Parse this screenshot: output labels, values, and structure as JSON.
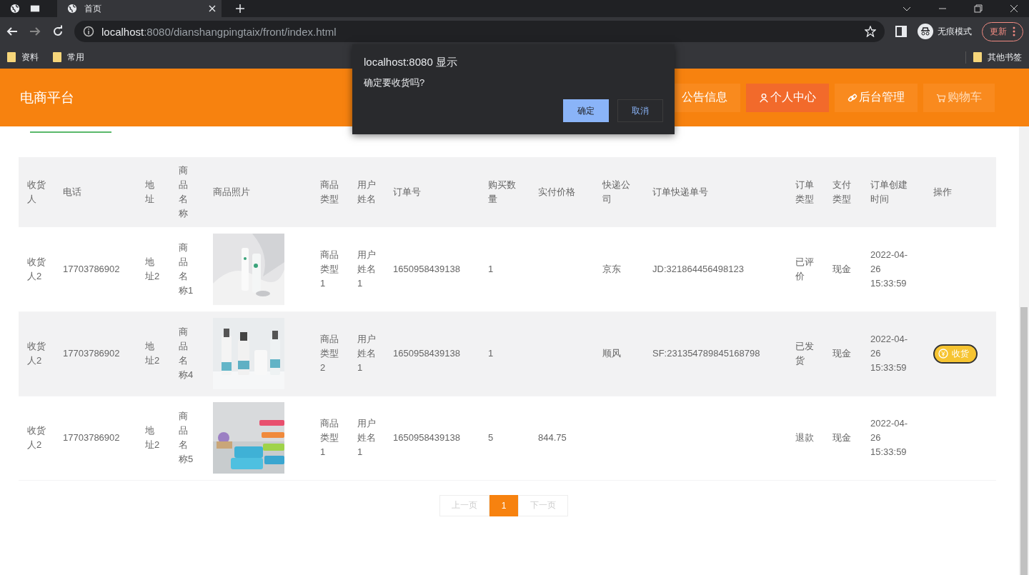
{
  "browser": {
    "tab_title": "首页",
    "url_host": "localhost",
    "url_rest": ":8080/dianshangpingtaix/front/index.html",
    "profile_label": "无痕模式",
    "update_button": "更新",
    "bookmarks": [
      "资料",
      "常用"
    ],
    "other_bookmarks": "其他书签"
  },
  "header": {
    "brand": "电商平台",
    "nav": [
      {
        "label": "公告信息",
        "kind": "plain",
        "selected": false
      },
      {
        "label": "个人中心",
        "kind": "user",
        "selected": true
      },
      {
        "label": "后台管理",
        "kind": "link",
        "selected": false
      },
      {
        "label": "购物车",
        "kind": "cart",
        "selected": false
      }
    ]
  },
  "table": {
    "columns": [
      "收货人",
      "电话",
      "地址",
      "商品名称",
      "商品照片",
      "商品类型",
      "用户姓名",
      "订单号",
      "购买数量",
      "实付价格",
      "快递公司",
      "订单快递单号",
      "订单类型",
      "支付类型",
      "订单创建时间",
      "操作"
    ],
    "rows": [
      {
        "consignee": "收货人2",
        "phone": "17703786902",
        "address": "地址2",
        "product_name": "商品名称1",
        "product_type": "商品类型1",
        "user_name": "用户姓名1",
        "order_no": "1650958439138",
        "quantity": "1",
        "courier": "京东",
        "tracking_no": "JD:321864456498123",
        "order_type": "已评价",
        "payment_type": "现金",
        "created": "2022-04-26 15:33:59",
        "highlighted": false
      },
      {
        "consignee": "收货人2",
        "phone": "17703786902",
        "address": "地址2",
        "product_name": "商品名称4",
        "product_type": "商品类型2",
        "user_name": "用户姓名1",
        "order_no": "1650958439138",
        "quantity": "1",
        "courier": "顺风",
        "tracking_no": "SF:231354789845168798",
        "order_type": "已发货",
        "payment_type": "现金",
        "created": "2022-04-26 15:33:59",
        "action": "收货",
        "highlighted": true
      },
      {
        "consignee": "收货人2",
        "phone": "17703786902",
        "address": "地址2",
        "product_name": "商品名称5",
        "product_type": "商品类型1",
        "user_name": "用户姓名1",
        "order_no": "1650958439138",
        "quantity": "5",
        "price": "844.75",
        "order_type": "退款",
        "payment_type": "现金",
        "created": "2022-04-26 15:33:59",
        "highlighted": false
      }
    ]
  },
  "pagination": {
    "prev": "上一页",
    "pages": [
      {
        "label": "1",
        "selected": true
      }
    ],
    "next": "下一页"
  },
  "dialog": {
    "title": "localhost:8080 显示",
    "message": "确定要收货吗?",
    "buttons": [
      {
        "label": "确定",
        "kind": "primary"
      },
      {
        "label": "取消",
        "kind": "secondary"
      }
    ]
  }
}
